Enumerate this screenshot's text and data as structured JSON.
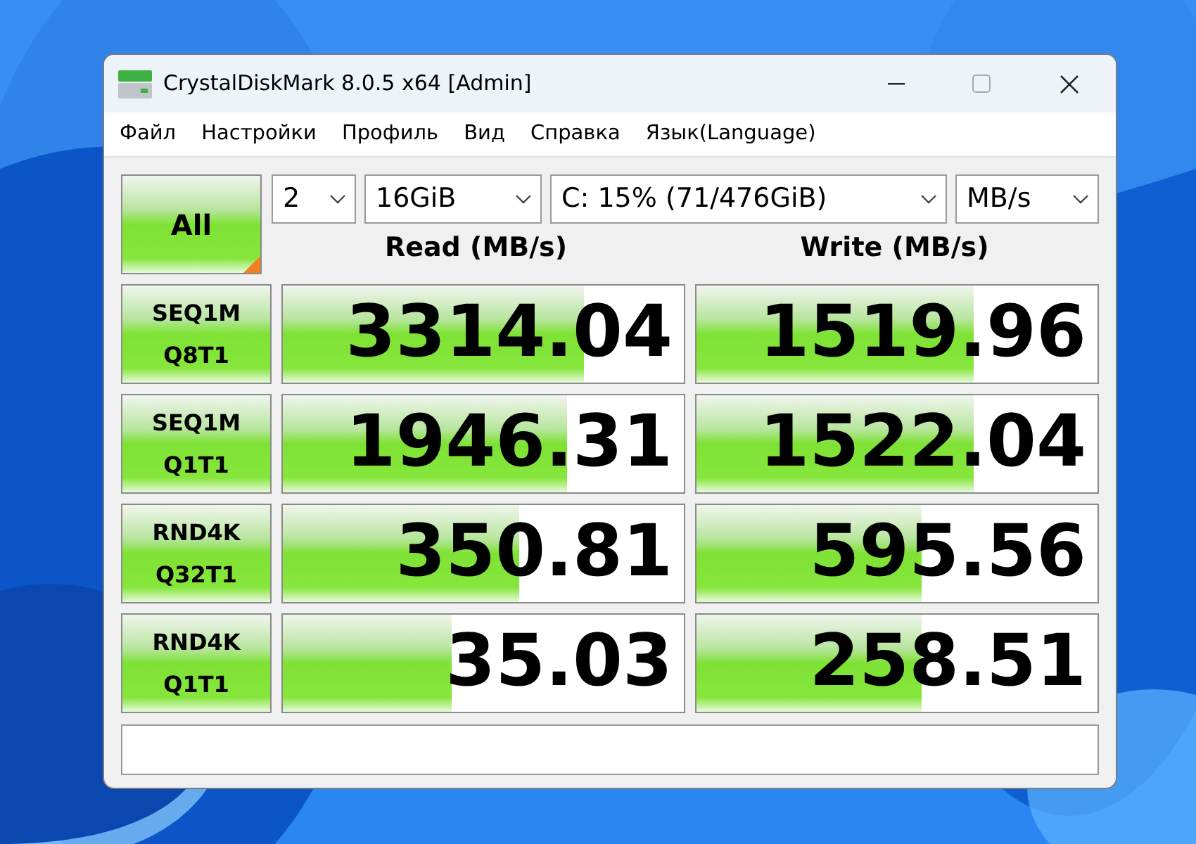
{
  "window": {
    "title": "CrystalDiskMark 8.0.5 x64 [Admin]"
  },
  "menu": [
    "Файл",
    "Настройки",
    "Профиль",
    "Вид",
    "Справка",
    "Язык(Language)"
  ],
  "all_button": "All",
  "selects": [
    {
      "value": "2"
    },
    {
      "value": "16GiB"
    },
    {
      "value": "C: 15% (71/476GiB)"
    },
    {
      "value": "MB/s"
    }
  ],
  "columns": [
    "Read (MB/s)",
    "Write (MB/s)"
  ],
  "tests": [
    {
      "label": [
        "SEQ1M",
        "Q8T1"
      ],
      "read": {
        "value": "3314.04",
        "level": 0.75
      },
      "write": {
        "value": "1519.96",
        "level": 0.69
      }
    },
    {
      "label": [
        "SEQ1M",
        "Q1T1"
      ],
      "read": {
        "value": "1946.31",
        "level": 0.71
      },
      "write": {
        "value": "1522.04",
        "level": 0.69
      }
    },
    {
      "label": [
        "RND4K",
        "Q32T1"
      ],
      "read": {
        "value": "350.81",
        "level": 0.59
      },
      "write": {
        "value": "595.56",
        "level": 0.56
      }
    },
    {
      "label": [
        "RND4K",
        "Q1T1"
      ],
      "read": {
        "value": "35.03",
        "level": 0.42
      },
      "write": {
        "value": "258.51",
        "level": 0.56
      }
    }
  ]
}
